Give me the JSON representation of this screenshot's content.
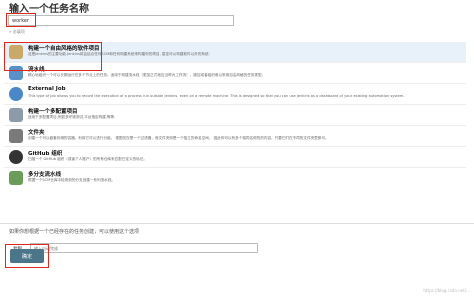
{
  "page": {
    "title": "输入一个任务名称",
    "name_value": "worker",
    "required_hint": "» 必填项"
  },
  "item_types": [
    {
      "label": "构建一个自由风格的软件项目",
      "desc": "这是Jenkins的主要功能.Jenkins将会结合任何SCM和任何构建系统来构建你的项目, 甚至可以构建软件以外的系统.",
      "icon": "freestyle-icon",
      "color": "#c9a86a"
    },
    {
      "label": "流水线",
      "desc": "精心地组织一个可以长期运行在多个节点上的任务。适用于构建流水线（更加正式地应当称为工作流），增加或者组织难以采用自由风格的任务类型。",
      "icon": "pipeline-icon",
      "color": "#5b8fc7"
    },
    {
      "label": "External Job",
      "desc": "This type of job allows you to record the execution of a process run outside Jenkins, even on a remote machine. This is designed so that you can use Jenkins as a dashboard of your existing automation system.",
      "icon": "external-job-icon",
      "color": "#4a88c8"
    },
    {
      "label": "构建一个多配置项目",
      "desc": "适用于多配置项目,例如多环境测试,平台指定构建,等等.",
      "icon": "multi-config-icon",
      "color": "#8d9aa8"
    },
    {
      "label": "文件夹",
      "desc": "创建一个可以嵌套存储的容器。利用它可以进行分组。 视图仅仅是一个过滤器，而文件夹则是一个独立的命名空间， 因此你可以有多个相同名称的的内容，只要它们在不同的文件夹里即可。",
      "icon": "folder-icon",
      "color": "#7a7a7a"
    },
    {
      "label": "GitHub 组织",
      "desc": "扫描一个 GitHub 组织（或者个人账户）的所有仓库来匹配已定义的标记。",
      "icon": "github-icon",
      "color": "#333333"
    },
    {
      "label": "多分支流水线",
      "desc": "根据一个SCM仓库中检测到的分支创建一系列流水线。",
      "icon": "multibranch-icon",
      "color": "#6b9c5a"
    }
  ],
  "copy": {
    "hint": "如果你想根据一个已经存在的任务创建，可以使用这个选项",
    "label": "复制",
    "placeholder": "输入自动完成"
  },
  "ok_label": "确定",
  "watermark": "https://blog.csdn.net/..."
}
